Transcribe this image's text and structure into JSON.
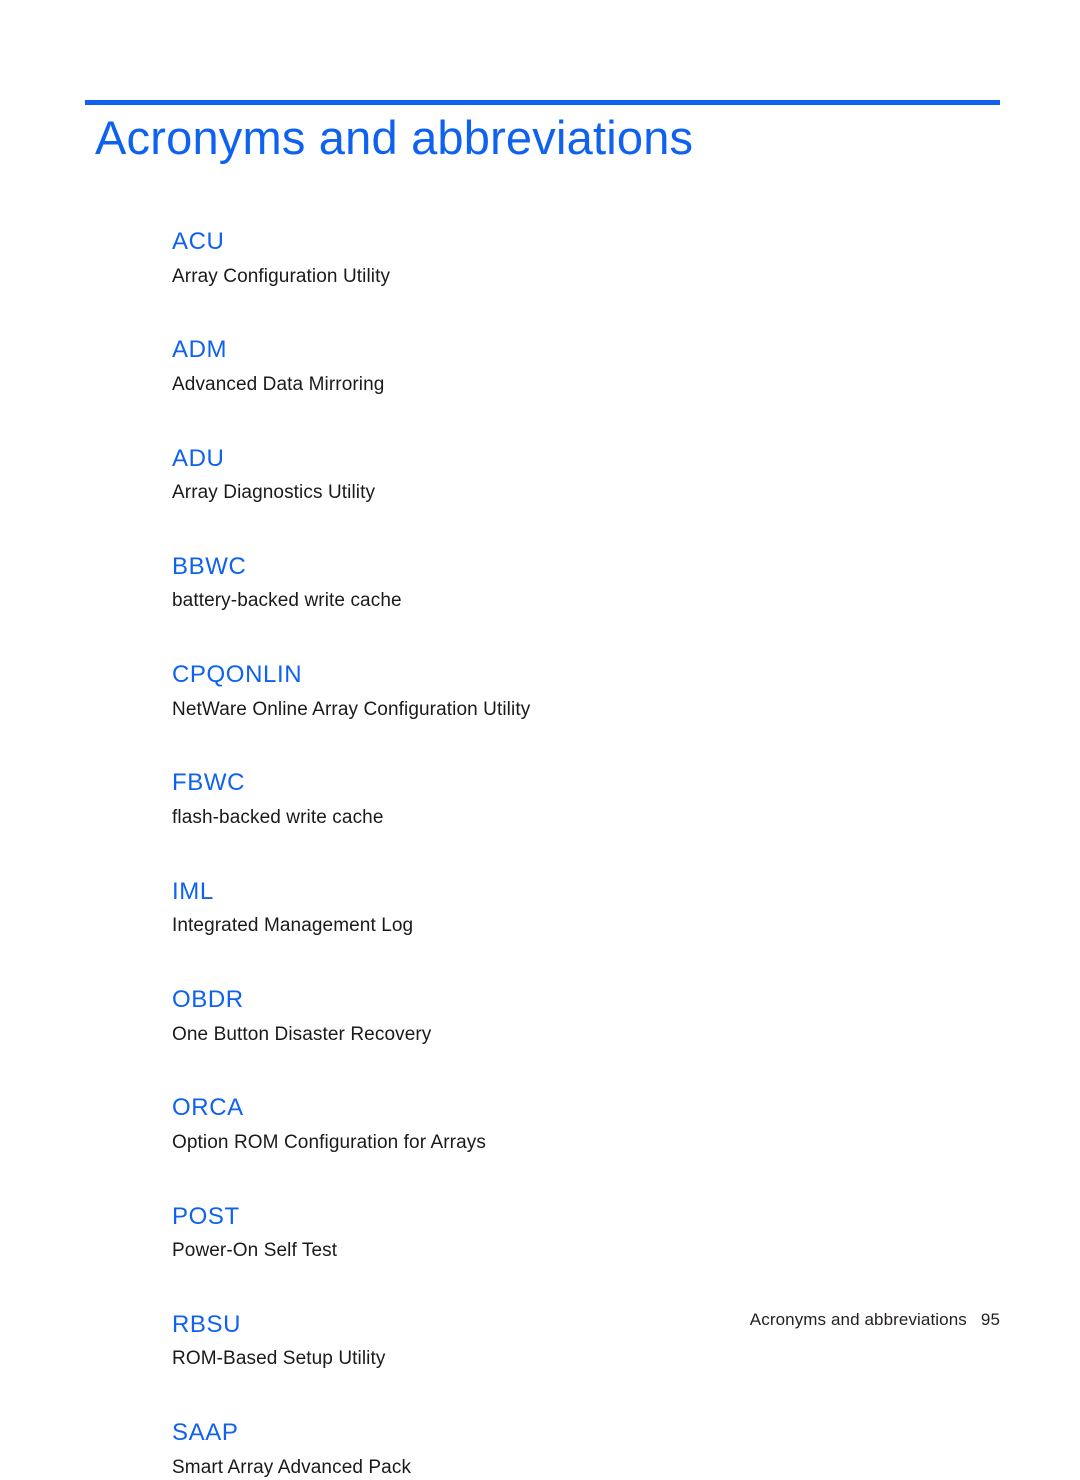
{
  "document": {
    "page_title": "Acronyms and abbreviations",
    "accent_color": "#0f62f0",
    "text_color": "#1a1a1a",
    "background_color": "#ffffff"
  },
  "glossary": {
    "entries": [
      {
        "term": "ACU",
        "definition": "Array Configuration Utility"
      },
      {
        "term": "ADM",
        "definition": "Advanced Data Mirroring"
      },
      {
        "term": "ADU",
        "definition": "Array Diagnostics Utility"
      },
      {
        "term": "BBWC",
        "definition": "battery-backed write cache"
      },
      {
        "term": "CPQONLIN",
        "definition": "NetWare Online Array Configuration Utility"
      },
      {
        "term": "FBWC",
        "definition": "flash-backed write cache"
      },
      {
        "term": "IML",
        "definition": "Integrated Management Log"
      },
      {
        "term": "OBDR",
        "definition": "One Button Disaster Recovery"
      },
      {
        "term": "ORCA",
        "definition": "Option ROM Configuration for Arrays"
      },
      {
        "term": "POST",
        "definition": "Power-On Self Test"
      },
      {
        "term": "RBSU",
        "definition": "ROM-Based Setup Utility"
      },
      {
        "term": "SAAP",
        "definition": "Smart Array Advanced Pack"
      }
    ]
  },
  "footer": {
    "chapter": "Acronyms and abbreviations",
    "page_number": "95"
  }
}
